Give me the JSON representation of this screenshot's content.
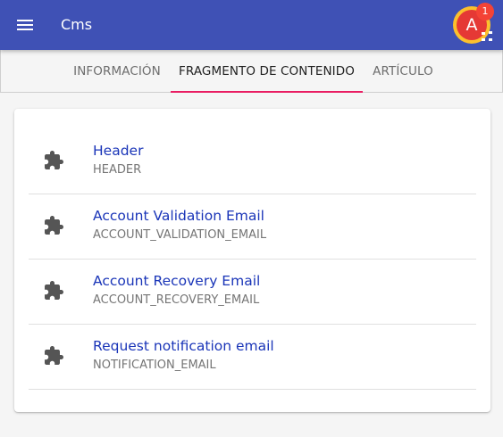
{
  "toolbar": {
    "title": "Cms",
    "avatar_initial": "A",
    "notification_count": "1",
    "color": "#3f51b5"
  },
  "tabs": [
    {
      "label": "INFORMACIÓN",
      "active": false
    },
    {
      "label": "FRAGMENTO DE CONTENIDO",
      "active": true
    },
    {
      "label": "ARTÍCULO",
      "active": false
    }
  ],
  "fragments": [
    {
      "title": "Header",
      "code": "HEADER",
      "icon": "puzzle-icon"
    },
    {
      "title": "Account Validation Email",
      "code": "ACCOUNT_VALIDATION_EMAIL",
      "icon": "puzzle-icon"
    },
    {
      "title": "Account Recovery Email",
      "code": "ACCOUNT_RECOVERY_EMAIL",
      "icon": "puzzle-icon"
    },
    {
      "title": "Request notification email",
      "code": "NOTIFICATION_EMAIL",
      "icon": "puzzle-icon"
    }
  ],
  "colors": {
    "accent": "#e91e63",
    "link": "#1a35b8",
    "avatar_ring": "#fbc02d",
    "avatar": "#e53935"
  }
}
